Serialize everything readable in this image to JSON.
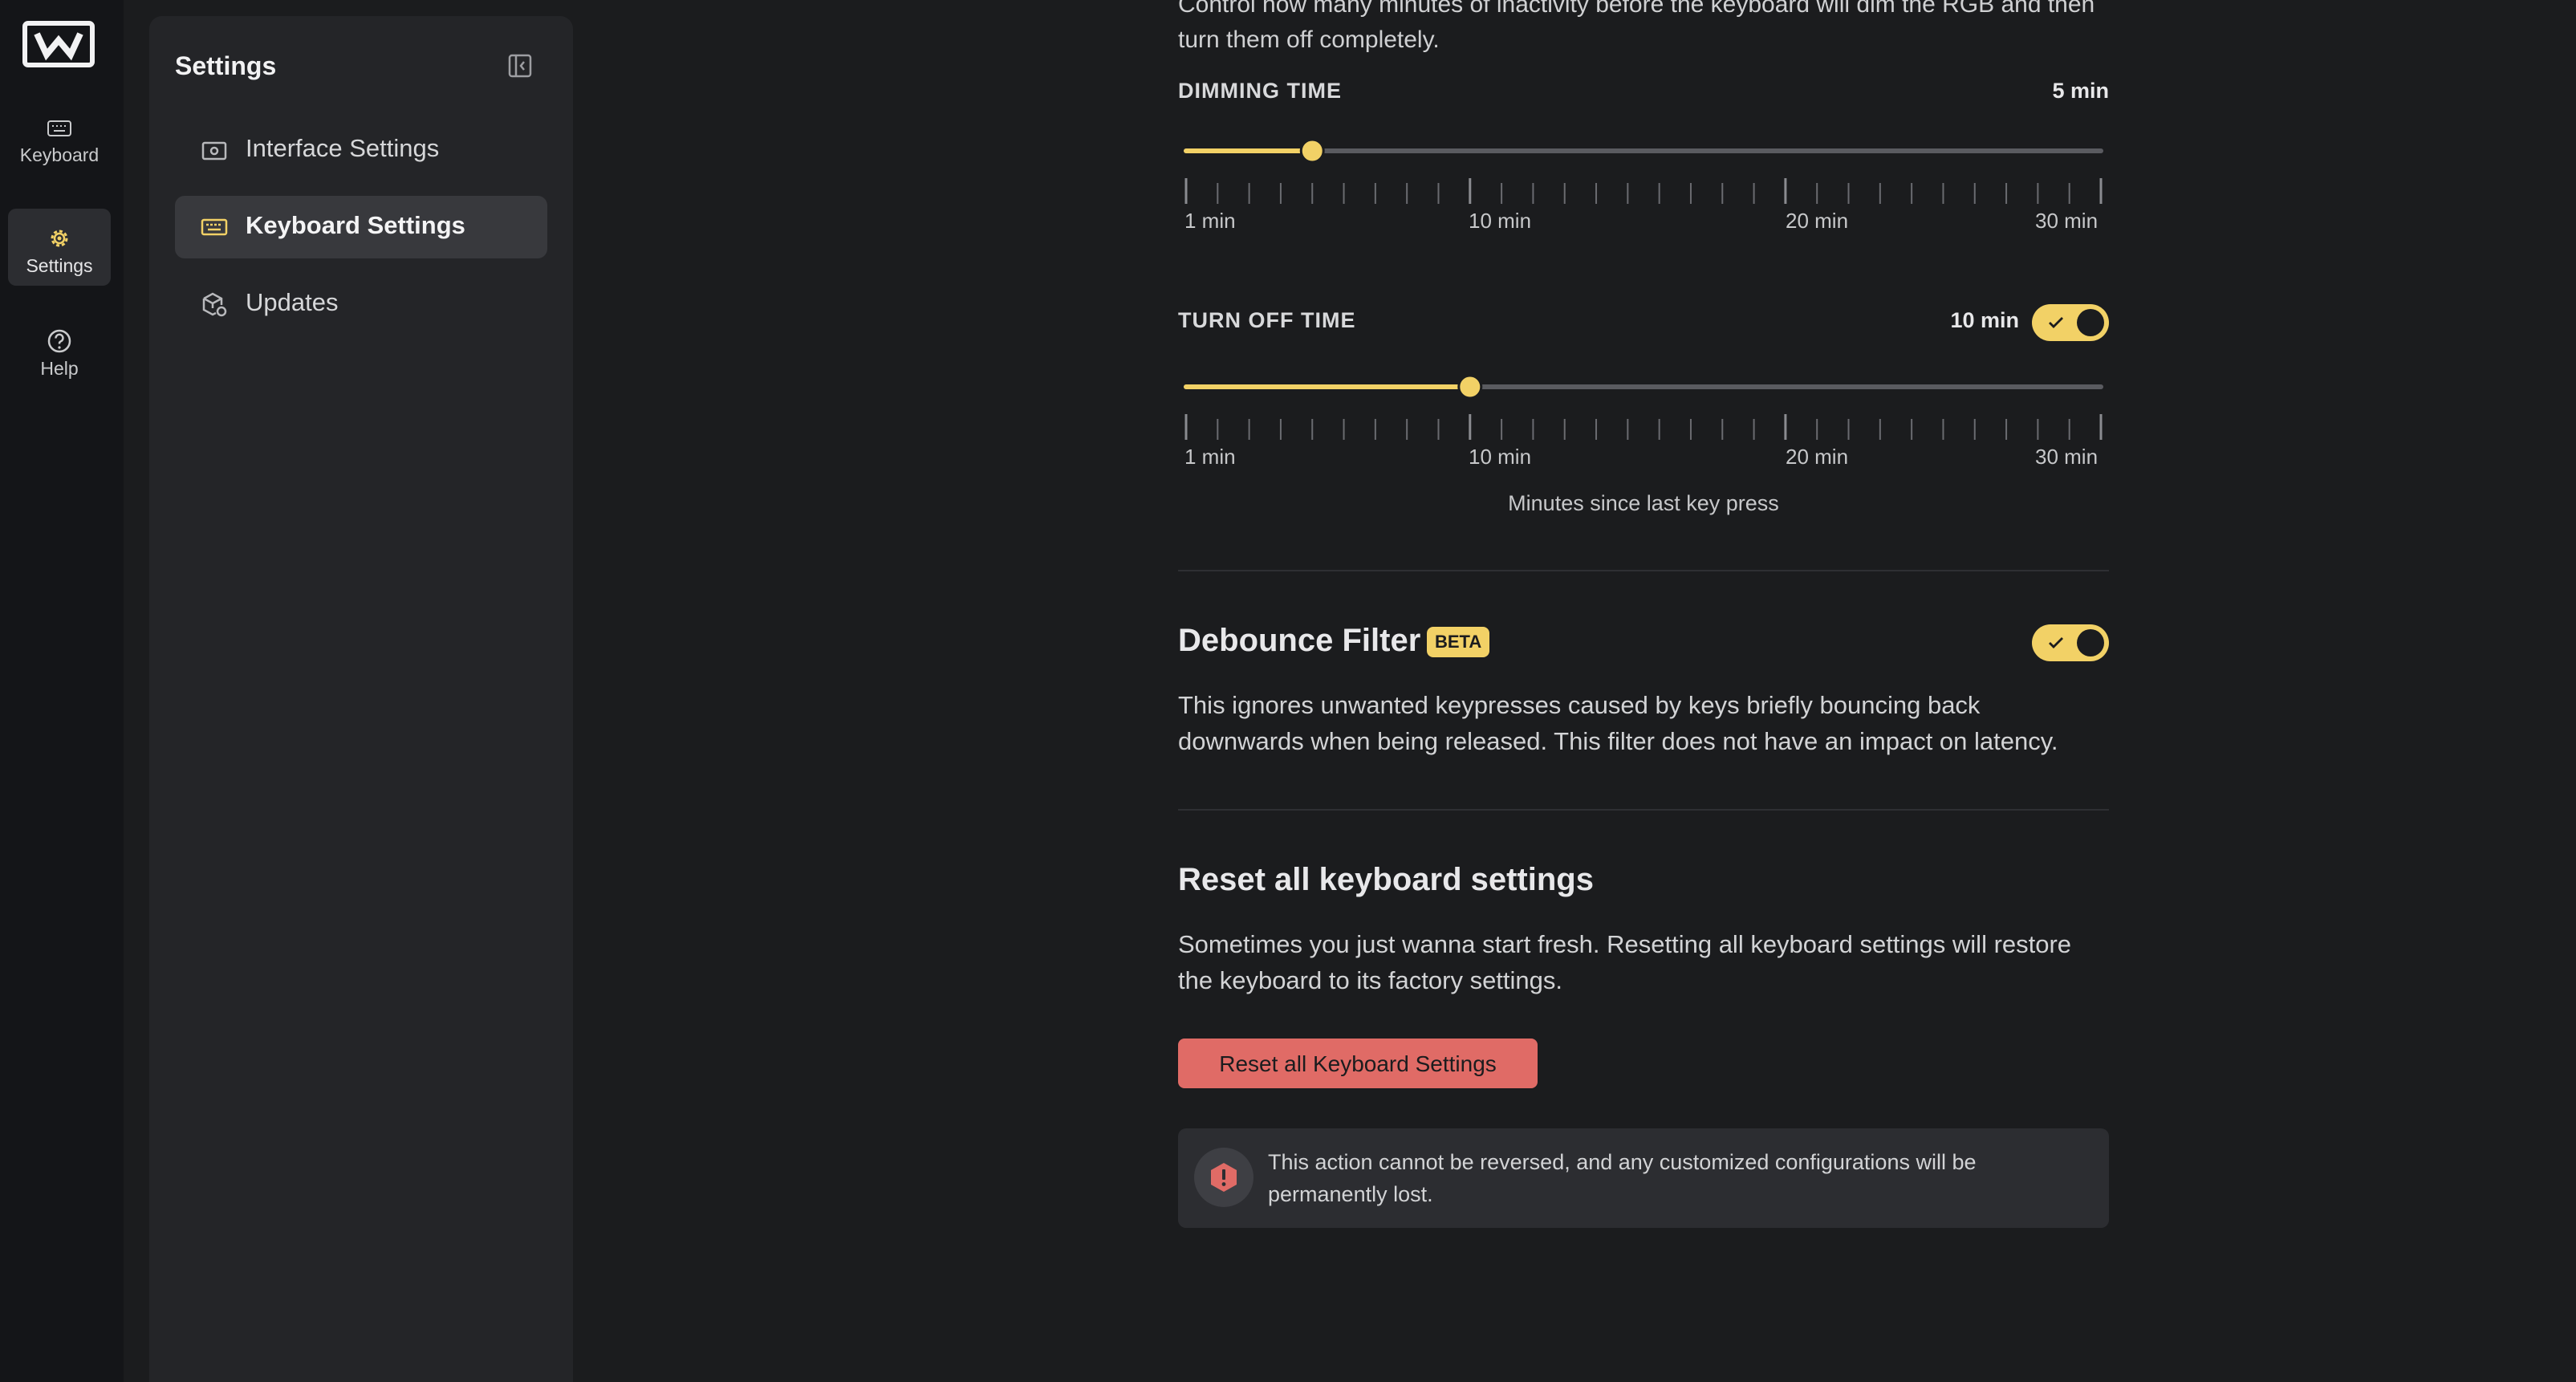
{
  "rail": {
    "items": [
      {
        "label": "Keyboard",
        "icon": "keyboard-icon"
      },
      {
        "label": "Settings",
        "icon": "gear-icon"
      },
      {
        "label": "Help",
        "icon": "help-icon"
      }
    ]
  },
  "sidebar": {
    "title": "Settings",
    "items": [
      {
        "label": "Interface Settings",
        "icon": "interface-icon"
      },
      {
        "label": "Keyboard Settings",
        "icon": "keyboard-icon"
      },
      {
        "label": "Updates",
        "icon": "updates-icon"
      }
    ]
  },
  "rgb": {
    "intro": "Control how many minutes of inactivity before the keyboard will dim the RGB and then turn them off completely.",
    "dimming": {
      "label": "DIMMING TIME",
      "value_text": "5 min",
      "value": 5,
      "min": 1,
      "max": 30
    },
    "turnoff": {
      "label": "TURN OFF TIME",
      "value_text": "10 min",
      "value": 10,
      "min": 1,
      "max": 30,
      "enabled": true
    },
    "tick_labels": [
      "1 min",
      "10 min",
      "20 min",
      "30 min"
    ],
    "caption": "Minutes since last key press"
  },
  "debounce": {
    "title": "Debounce Filter",
    "badge": "BETA",
    "enabled": true,
    "description": "This ignores unwanted keypresses caused by keys briefly bouncing back downwards when being released. This filter does not have an impact on latency."
  },
  "reset": {
    "title": "Reset all keyboard settings",
    "description": "Sometimes you just wanna start fresh. Resetting all keyboard settings will restore the keyboard to its factory settings.",
    "button": "Reset all Keyboard Settings",
    "warning": "This action cannot be reversed, and any customized configurations will be permanently lost."
  },
  "colors": {
    "accent": "#f2d166",
    "danger": "#e06b66",
    "background": "#1b1c1e"
  }
}
